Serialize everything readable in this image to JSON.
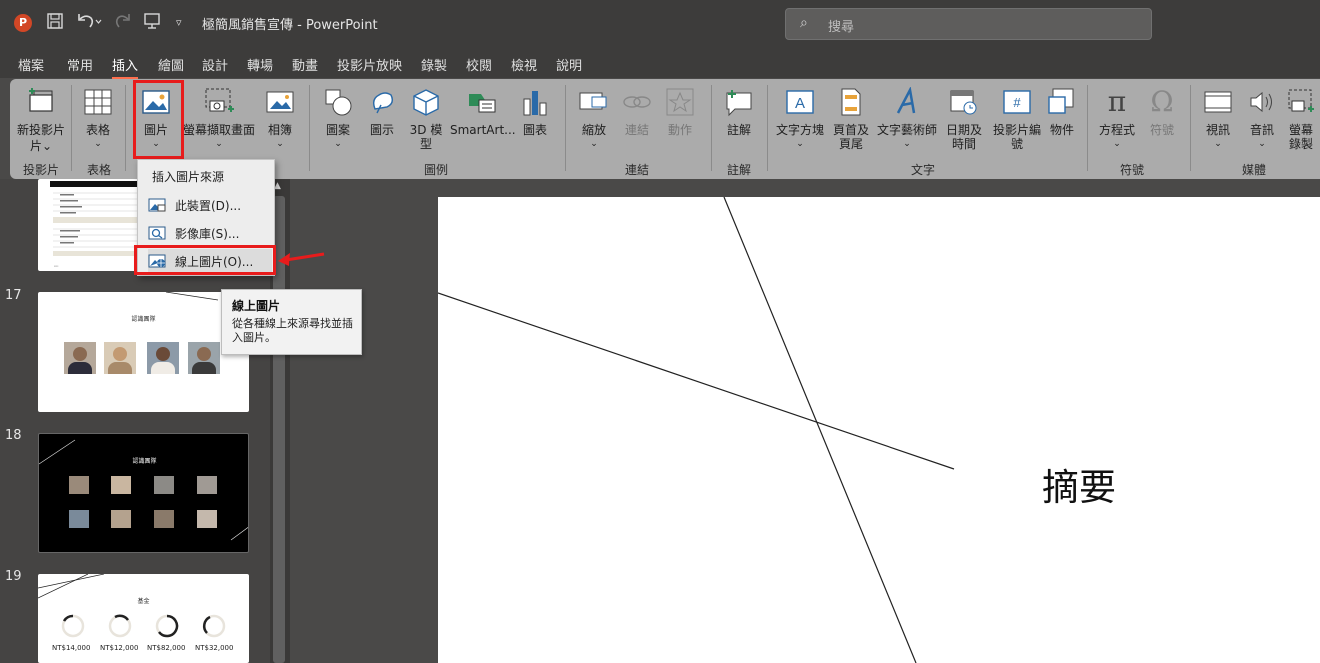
{
  "titlebar": {
    "app_letter": "P",
    "doc_title": "極簡風銷售宣傳 - PowerPoint",
    "search_placeholder": "搜尋"
  },
  "menu_tabs": [
    "檔案",
    "常用",
    "插入",
    "繪圖",
    "設計",
    "轉場",
    "動畫",
    "投影片放映",
    "錄製",
    "校閱",
    "檢視",
    "說明"
  ],
  "active_tab": "插入",
  "ribbon": {
    "new_slide": "新投影片",
    "table": "表格",
    "pictures": "圖片",
    "screenshot": "螢幕擷取畫面",
    "album": "相簿",
    "shapes": "圖案",
    "icons": "圖示",
    "models3d": "3D 模型",
    "smartart": "SmartArt...",
    "chart": "圖表",
    "zoom": "縮放",
    "link": "連結",
    "action": "動作",
    "comment": "註解",
    "textbox": "文字方塊",
    "header_footer": "頁首及頁尾",
    "wordart": "文字藝術師",
    "datetime": "日期及時間",
    "slide_number": "投影片編號",
    "object": "物件",
    "equation": "方程式",
    "symbol": "符號",
    "video": "視訊",
    "audio": "音訊",
    "screen_record": "螢幕錄製"
  },
  "groups": {
    "slides": "投影片",
    "tables": "表格",
    "illustrations": "圖例",
    "links": "連結",
    "comments": "註解",
    "text": "文字",
    "symbols": "符號",
    "media": "媒體"
  },
  "dropdown": {
    "header": "插入圖片來源",
    "items": [
      "此裝置(D)...",
      "影像庫(S)...",
      "線上圖片(O)..."
    ]
  },
  "tooltip": {
    "title": "線上圖片",
    "body": "從各種線上來源尋找並插入圖片。"
  },
  "slides": {
    "num17": "17",
    "num18": "18",
    "num19": "19",
    "s17_title": "認識團隊",
    "s18_title": "認識團隊",
    "s19_title": "基金",
    "s19_values": [
      "NT$14,000",
      "NT$12,000",
      "NT$82,000",
      "NT$32,000"
    ]
  },
  "main_slide": {
    "title": "摘要"
  },
  "colors": {
    "accent_tab": "#ff6f4e",
    "highlight": "#e81c1c",
    "ribbon_bg": "#ababab"
  }
}
